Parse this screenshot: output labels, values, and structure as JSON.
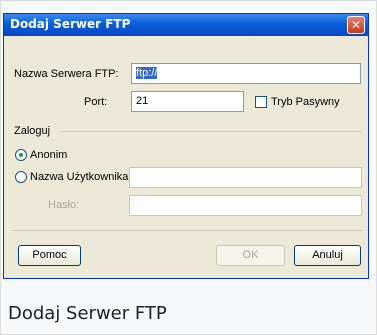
{
  "dialog": {
    "title": "Dodaj Serwer FTP",
    "close_icon": "close-icon",
    "server_name_label": "Nazwa Serwera FTP:",
    "server_name_value": "ftp://",
    "port_label": "Port:",
    "port_value": "21",
    "passive_label": "Tryb Pasywny",
    "passive_checked": false,
    "login_group_label": "Zaloguj",
    "anonymous_label": "Anonim",
    "anonymous_selected": true,
    "username_label": "Nazwa Użytkownika:",
    "password_label": "Hasło:",
    "help_button": "Pomoc",
    "ok_button": "OK",
    "cancel_button": "Anuluj"
  },
  "caption": "Dodaj Serwer FTP",
  "colors": {
    "titlebar": "#0a5fd8",
    "window_bg": "#ece9d8",
    "close_button": "#c63b1a",
    "selection": "#316ac5"
  }
}
